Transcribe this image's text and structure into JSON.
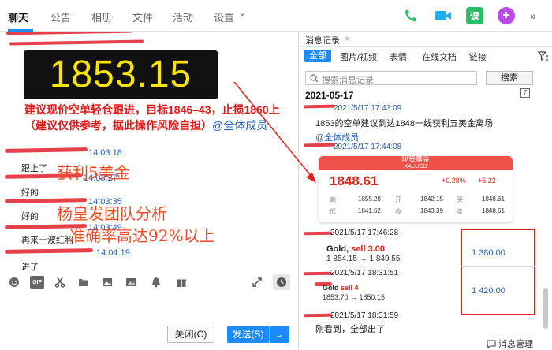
{
  "top_tabs": [
    "聊天",
    "公告",
    "相册",
    "文件",
    "活动",
    "设置"
  ],
  "top_dropdown_glyph": "⌄",
  "chat": {
    "big_price": "1853.15",
    "advice": "建议现价空单轻仓跟进，目标1846–43，止损1860上（建议仅供参考，据此操作风险自担）",
    "advice_mention": "@全体成员",
    "messages": [
      {
        "time": "14:03:18",
        "text": "跟上了"
      },
      {
        "time": "14:03:27",
        "text": "好的"
      },
      {
        "time": "14:03:35",
        "text": "好的"
      },
      {
        "time": "14:03:49",
        "text": "再来一波红利"
      },
      {
        "time": "14:04:19",
        "text": "进了"
      }
    ],
    "overlay_profit": "获利5美金",
    "overlay_team": "杨皇发团队分析",
    "overlay_accuracy": "准确率高达92%以上"
  },
  "toolbar_icons": [
    "emoji-icon",
    "gif-icon",
    "scissors-icon",
    "folder-icon",
    "image-icon",
    "bell-icon",
    "gift-icon",
    "expand-icon",
    "clock-icon"
  ],
  "toolbar_gif": "GIF",
  "buttons": {
    "close": "关闭(C)",
    "send": "发送(S)",
    "send_dropdown": "⌄"
  },
  "history": {
    "title": "消息记录",
    "close": "×",
    "filters": [
      "全部",
      "图片/视频",
      "表情",
      "在线文档",
      "链接"
    ],
    "search_placeholder": "搜索消息记录",
    "search_button": "搜索",
    "date": "2021-05-17",
    "calendar": "7",
    "entries": [
      {
        "time": "2021/5/17 17:43:09",
        "text": "1853的空单建议到达1848一线获利五美金离场",
        "mention": "@全体成员"
      },
      {
        "time": "2021/5/17 17:44:08"
      },
      {
        "time": "2021/5/17 17:46:28"
      },
      {
        "time": "2021/5/17 18:31:51"
      },
      {
        "time": "2021/5/17 18:31:59",
        "text": "刚看到，全部出了"
      }
    ],
    "quote": {
      "header_symbol": "现货黄金",
      "header_code": "XAUUSD",
      "price": "1848.61",
      "change_pct": "+0.28%",
      "change_abs": "+5.22",
      "rows": [
        [
          [
            "高",
            "1855.28"
          ],
          [
            "开",
            "1842.15"
          ],
          [
            "买",
            "1848.61"
          ]
        ],
        [
          [
            "低",
            "1841.62"
          ],
          [
            "收",
            "1843.39"
          ],
          [
            "卖",
            "1848.61"
          ]
        ]
      ]
    },
    "trades": [
      {
        "name": "Gold,",
        "side": "sell 3.00",
        "prices": "1 854.15 → 1 849.55",
        "profit": "1 380.00"
      },
      {
        "name": "Gold",
        "side": "sell 4",
        "prices": "1853.70 → 1850.15",
        "profit": "1 420.00"
      }
    ],
    "management": "消息管理"
  },
  "colors": {
    "accent": "#1a8cff",
    "red": "#e2221b",
    "phone": "#2bbf6a",
    "video": "#1fb0e8",
    "class": "#2bbf6a",
    "plus": "#b84ce6"
  }
}
